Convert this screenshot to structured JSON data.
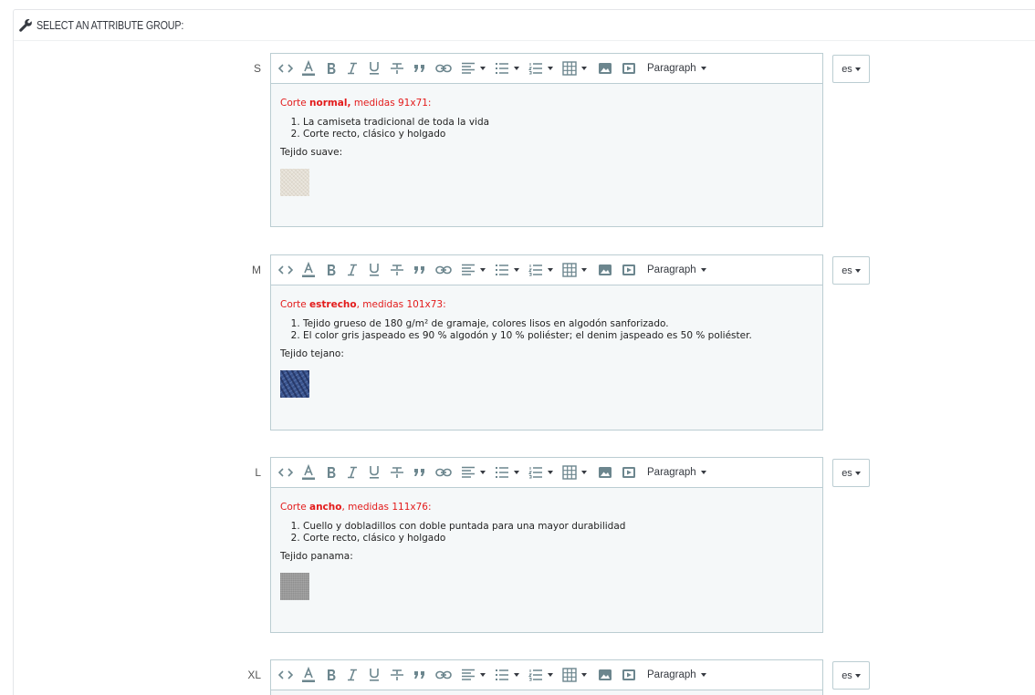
{
  "header": {
    "title": "SELECT AN ATTRIBUTE GROUP:",
    "icon": "wrench-icon"
  },
  "toolbar": {
    "paragraph_label": "Paragraph",
    "icon_color": "#6c868e"
  },
  "rows": [
    {
      "size": "S",
      "lang": "es",
      "lead_prefix": "Corte ",
      "lead_bold": "normal,",
      "lead_suffix": " medidas 91x71:",
      "items": [
        "La camiseta tradicional de toda la vida",
        "Corte recto, clásico y holgado"
      ],
      "fabric": "Tejido suave:",
      "swatch_color": "#e4ded3"
    },
    {
      "size": "M",
      "lang": "es",
      "lead_prefix": "Corte ",
      "lead_bold": "estrecho",
      "lead_suffix": ", medidas 101x73:",
      "items": [
        "Tejido grueso de 180 g/m² de gramaje, colores lisos en algodón sanforizado.",
        "El color gris jaspeado es 90 % algodón y 10 % poliéster; el denim jaspeado es 50 % poliéster."
      ],
      "fabric": "Tejido tejano:",
      "swatch_color": "#3b5690"
    },
    {
      "size": "L",
      "lang": "es",
      "lead_prefix": "Corte ",
      "lead_bold": "ancho",
      "lead_suffix": ", medidas 111x76:",
      "items": [
        "Cuello y dobladillos con doble puntada para una mayor durabilidad",
        "Corte recto, clásico y holgado"
      ],
      "fabric": "Tejido panama:",
      "swatch_color": "#9a9a9a"
    },
    {
      "size": "XL",
      "lang": "es"
    }
  ]
}
